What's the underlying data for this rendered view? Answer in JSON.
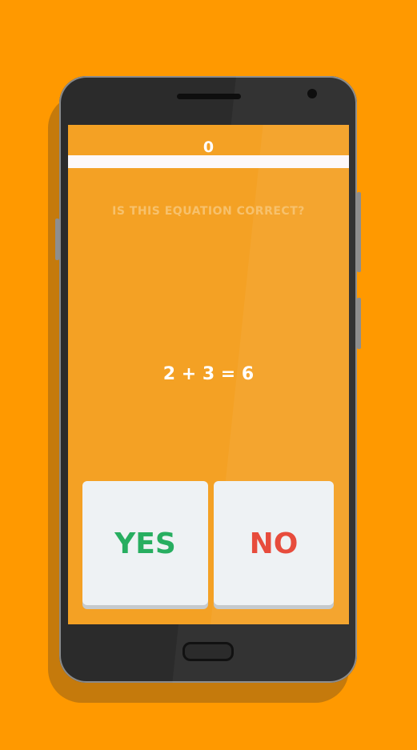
{
  "game": {
    "score": "0",
    "progress_fraction": 1.0,
    "question": "IS THIS EQUATION CORRECT?",
    "equation": "2 + 3 = 6"
  },
  "buttons": {
    "yes_label": "YES",
    "no_label": "NO"
  },
  "colors": {
    "background": "#FF9900",
    "screen": "#F4A124",
    "yes": "#27AE60",
    "no": "#E74C3C"
  }
}
